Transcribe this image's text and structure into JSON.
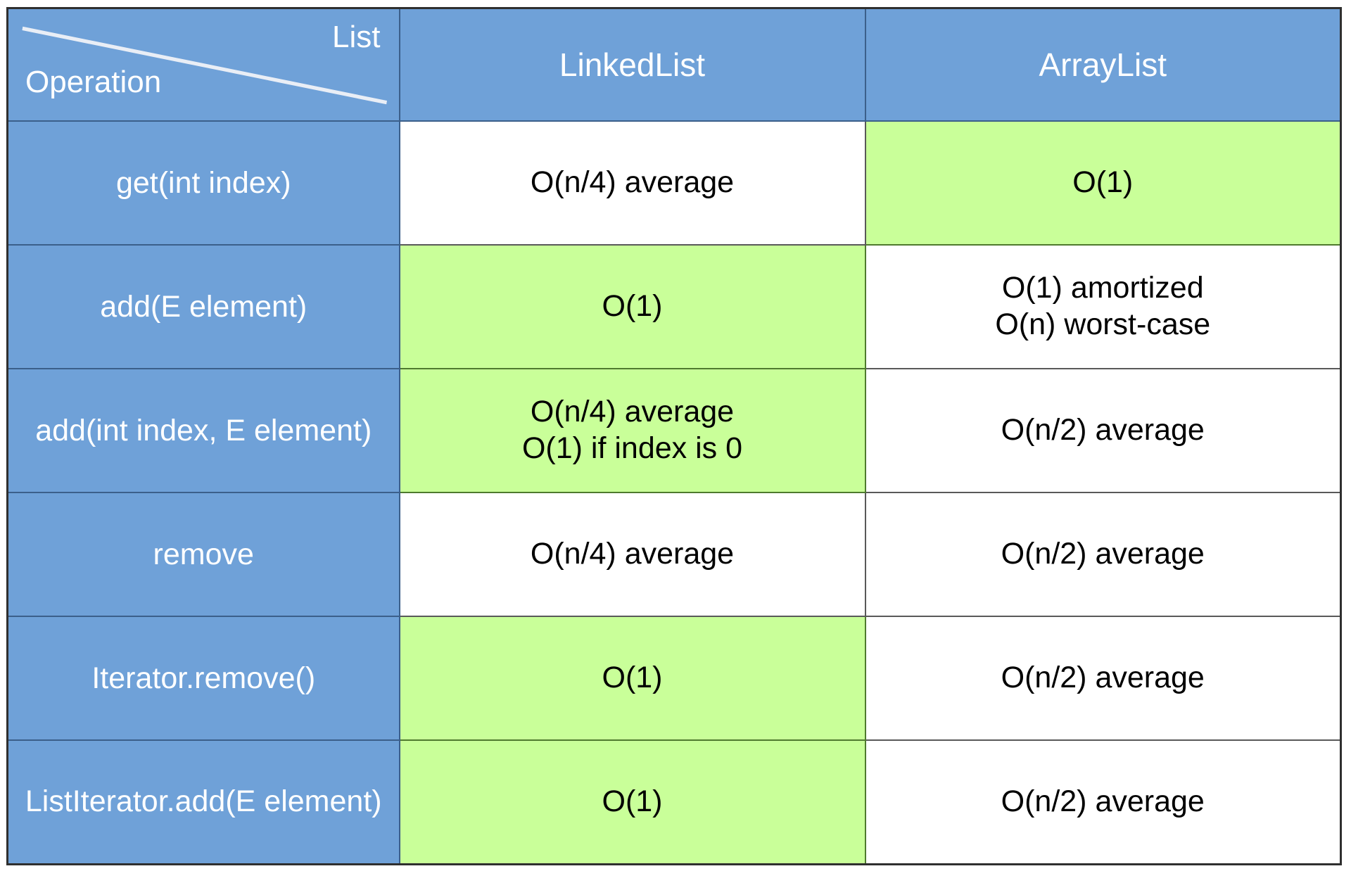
{
  "table": {
    "corner": {
      "column_axis_label": "List",
      "row_axis_label": "Operation",
      "divider": "diagonal-line"
    },
    "columns": [
      {
        "key": "operation",
        "label": "Operation"
      },
      {
        "key": "linkedlist",
        "label": "LinkedList"
      },
      {
        "key": "arraylist",
        "label": "ArrayList"
      }
    ],
    "colors": {
      "header_blue": "#6fa1d8",
      "row_header_blue": "#6fa1d8",
      "highlight_green": "#c9ff99",
      "plain_white": "#ffffff",
      "header_text": "#ffffff",
      "body_text": "#000000",
      "outer_border": "#2f2f2f"
    },
    "rows": [
      {
        "operation": "get(int index)",
        "linkedlist": {
          "lines": [
            "O(n/4) average"
          ],
          "highlight": "white"
        },
        "arraylist": {
          "lines": [
            "O(1)"
          ],
          "highlight": "green"
        }
      },
      {
        "operation": "add(E element)",
        "linkedlist": {
          "lines": [
            "O(1)"
          ],
          "highlight": "green"
        },
        "arraylist": {
          "lines": [
            "O(1) amortized",
            "O(n) worst-case"
          ],
          "highlight": "white"
        }
      },
      {
        "operation": "add(int index, E element)",
        "linkedlist": {
          "lines": [
            "O(n/4) average",
            "O(1) if index is 0"
          ],
          "highlight": "green"
        },
        "arraylist": {
          "lines": [
            "O(n/2) average"
          ],
          "highlight": "white"
        }
      },
      {
        "operation": "remove",
        "linkedlist": {
          "lines": [
            "O(n/4) average"
          ],
          "highlight": "white"
        },
        "arraylist": {
          "lines": [
            "O(n/2) average"
          ],
          "highlight": "white"
        }
      },
      {
        "operation": "Iterator.remove()",
        "linkedlist": {
          "lines": [
            "O(1)"
          ],
          "highlight": "green"
        },
        "arraylist": {
          "lines": [
            "O(n/2) average"
          ],
          "highlight": "white"
        }
      },
      {
        "operation": "ListIterator.add(E element)",
        "linkedlist": {
          "lines": [
            "O(1)"
          ],
          "highlight": "green"
        },
        "arraylist": {
          "lines": [
            "O(n/2) average"
          ],
          "highlight": "white"
        }
      }
    ]
  },
  "chart_data": {
    "type": "table",
    "title": "",
    "categories": [
      "get(int index)",
      "add(E element)",
      "add(int index, E element)",
      "remove",
      "Iterator.remove()",
      "ListIterator.add(E element)"
    ],
    "series": [
      {
        "name": "LinkedList",
        "values": [
          "O(n/4) average",
          "O(1)",
          "O(n/4) average; O(1) if index is 0",
          "O(n/4) average",
          "O(1)",
          "O(1)"
        ]
      },
      {
        "name": "ArrayList",
        "values": [
          "O(1)",
          "O(1) amortized; O(n) worst-case",
          "O(n/2) average",
          "O(n/2) average",
          "O(n/2) average",
          "O(n/2) average"
        ]
      }
    ]
  }
}
